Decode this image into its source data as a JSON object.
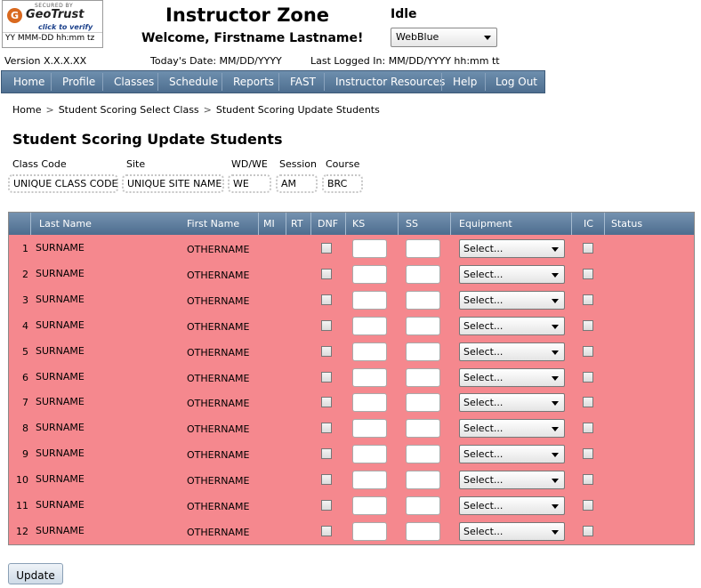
{
  "badge": {
    "secured_by": "SECURED BY",
    "brand": "GeoTrust",
    "click": "click to verify",
    "timestamp": "YY MMM-DD hh:mm tz"
  },
  "header": {
    "title": "Instructor Zone",
    "welcome": "Welcome, Firstname Lastname!",
    "status": "Idle",
    "theme_value": "WebBlue",
    "version": "Version X.X.X.XX",
    "todays_date": "Today's Date: MM/DD/YYYY",
    "last_logged": "Last Logged In: MM/DD/YYYY hh:mm tt"
  },
  "nav": {
    "items": [
      "Home",
      "Profile",
      "Classes",
      "Schedule",
      "Reports",
      "FAST",
      "Instructor Resources",
      "Help",
      "Log Out"
    ]
  },
  "breadcrumb": {
    "items": [
      "Home",
      "Student Scoring Select Class",
      "Student Scoring Update Students"
    ],
    "separator": ">"
  },
  "page": {
    "title": "Student Scoring Update Students"
  },
  "class_info": {
    "labels": [
      "Class Code",
      "Site",
      "WD/WE",
      "Session",
      "Course"
    ],
    "values": [
      "UNIQUE CLASS CODE",
      "UNIQUE SITE NAME",
      "WE",
      "AM",
      "BRC"
    ]
  },
  "table": {
    "columns": [
      "Last Name",
      "First Name",
      "MI",
      "RT",
      "DNF",
      "KS",
      "SS",
      "Equipment",
      "IC",
      "Status"
    ],
    "select_placeholder": "Select...",
    "rows": [
      {
        "num": "1",
        "last": "SURNAME",
        "first": "OTHERNAME"
      },
      {
        "num": "2",
        "last": "SURNAME",
        "first": "OTHERNAME"
      },
      {
        "num": "3",
        "last": "SURNAME",
        "first": "OTHERNAME"
      },
      {
        "num": "4",
        "last": "SURNAME",
        "first": "OTHERNAME"
      },
      {
        "num": "5",
        "last": "SURNAME",
        "first": "OTHERNAME"
      },
      {
        "num": "6",
        "last": "SURNAME",
        "first": "OTHERNAME"
      },
      {
        "num": "7",
        "last": "SURNAME",
        "first": "OTHERNAME"
      },
      {
        "num": "8",
        "last": "SURNAME",
        "first": "OTHERNAME"
      },
      {
        "num": "9",
        "last": "SURNAME",
        "first": "OTHERNAME"
      },
      {
        "num": "10",
        "last": "SURNAME",
        "first": "OTHERNAME"
      },
      {
        "num": "11",
        "last": "SURNAME",
        "first": "OTHERNAME"
      },
      {
        "num": "12",
        "last": "SURNAME",
        "first": "OTHERNAME"
      }
    ]
  },
  "actions": {
    "update_label": "Update"
  },
  "colors": {
    "row_background": "#f5888e",
    "nav_background": "#5a7a9b",
    "header_background": "#5f7f9f"
  }
}
